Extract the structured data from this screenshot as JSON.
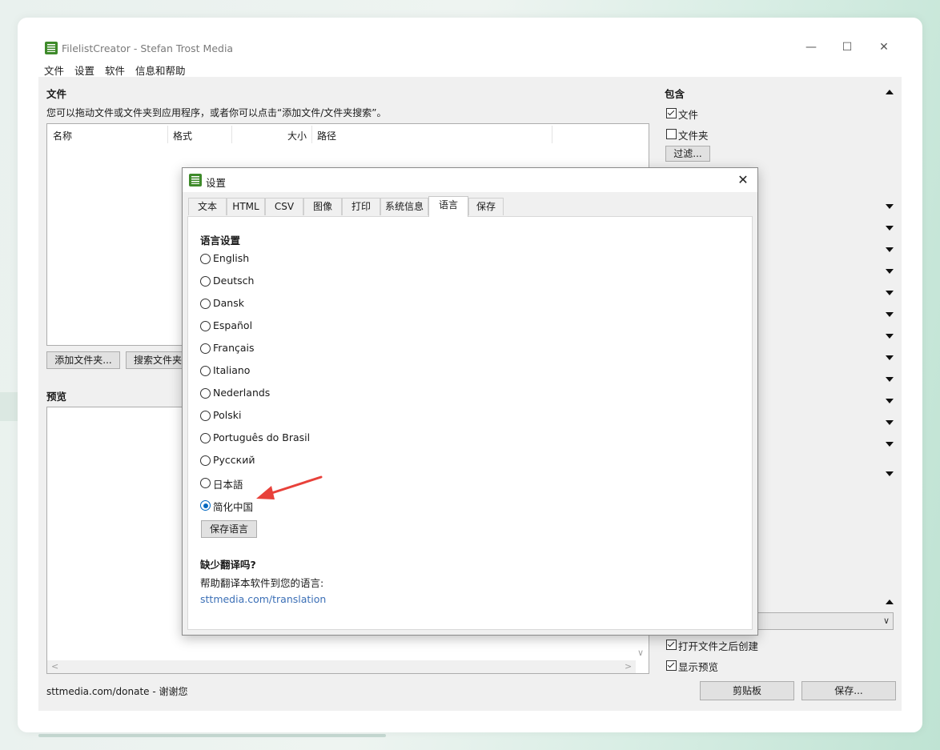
{
  "window": {
    "title": "FilelistCreator - Stefan Trost Media",
    "controls": {
      "minimize": "—",
      "maximize": "☐",
      "close": "✕"
    }
  },
  "menu": [
    "文件",
    "设置",
    "软件",
    "信息和帮助"
  ],
  "files_section": {
    "title": "文件",
    "hint": "您可以拖动文件或文件夹到应用程序，或者你可以点击“添加文件/文件夹搜索”。",
    "columns": [
      "名称",
      "格式",
      "大小",
      "路径"
    ],
    "add_folder_button": "添加文件夹...",
    "search_button": "搜索文件夹"
  },
  "preview_section": {
    "title": "预览"
  },
  "status": "sttmedia.com/donate - 谢谢您",
  "right_panel": {
    "include_title": "包含",
    "files_label": "文件",
    "folders_label": "文件夹",
    "filter_button": "过滤...",
    "open_after_create_label": "打开文件之后创建",
    "show_preview_label": "显示预览",
    "clipboard_button": "剪贴板",
    "save_button": "保存..."
  },
  "dialog": {
    "title": "设置",
    "close": "✕",
    "tabs": [
      "文本",
      "HTML",
      "CSV",
      "图像",
      "打印",
      "系统信息",
      "语言",
      "保存"
    ],
    "active_tab": "语言",
    "language_settings_title": "语言设置",
    "languages": [
      "English",
      "Deutsch",
      "Dansk",
      "Español",
      "Français",
      "Italiano",
      "Nederlands",
      "Polski",
      "Português do Brasil",
      "Русский",
      "日本語",
      "简化中国"
    ],
    "selected_language": "简化中国",
    "save_language_button": "保存语言",
    "missing_translation_title": "缺少翻译吗?",
    "help_text": "帮助翻译本软件到您的语言:",
    "translation_link": "sttmedia.com/translation"
  },
  "colors": {
    "accent": "#0067c0",
    "link": "#3b6fb6",
    "arrow": "#e8413a",
    "app_icon": "#3e8a2a"
  }
}
